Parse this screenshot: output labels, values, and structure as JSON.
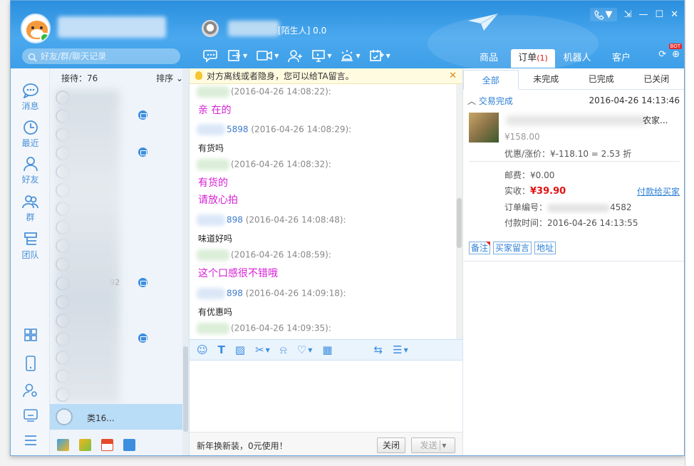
{
  "search": {
    "placeholder": "好友/群/聊天记录"
  },
  "contact": {
    "status": "[陌生人] 0.0"
  },
  "toolbar": {
    "icons": [
      "chat-transfer-icon",
      "share-screen-icon",
      "video-call-icon",
      "add-friend-icon",
      "remote-assist-icon",
      "alarm-icon",
      "calendar-task-icon"
    ]
  },
  "right_tabs": [
    {
      "label": "商品",
      "count": ""
    },
    {
      "label": "订单",
      "count": "(1)"
    },
    {
      "label": "机器人",
      "count": ""
    },
    {
      "label": "客户",
      "count": ""
    }
  ],
  "bot_badge": "BOT",
  "nav": [
    {
      "label": "消息",
      "icon": "message-icon"
    },
    {
      "label": "最近",
      "icon": "clock-icon"
    },
    {
      "label": "好友",
      "icon": "person-icon"
    },
    {
      "label": "群",
      "icon": "group-icon"
    },
    {
      "label": "团队",
      "icon": "team-icon"
    }
  ],
  "contact_list": {
    "reception_label": "接待：76",
    "sort_label": "排序",
    "selected_name": "类16...",
    "fragments": [
      "92"
    ]
  },
  "chat": {
    "notice": "对方离线或者隐身，您可以给TA留言。",
    "messages": [
      {
        "role": "seller",
        "name_frag": "",
        "time": "(2016-04-26 14:08:22):",
        "lines": [
          "亲 在的"
        ]
      },
      {
        "role": "customer",
        "name_frag": "5898",
        "time": "(2016-04-26 14:08:29):",
        "lines": [
          "有货吗"
        ]
      },
      {
        "role": "seller",
        "name_frag": "",
        "time": "(2016-04-26 14:08:32):",
        "lines": [
          "有货的",
          "请放心拍"
        ]
      },
      {
        "role": "customer",
        "name_frag": "898",
        "time": "(2016-04-26 14:08:48):",
        "lines": [
          "味道好吗"
        ]
      },
      {
        "role": "seller",
        "name_frag": "",
        "time": "(2016-04-26 14:08:59):",
        "lines": [
          "这个口感很不错哦"
        ]
      },
      {
        "role": "customer",
        "name_frag": "898",
        "time": "(2016-04-26 14:09:18):",
        "lines": [
          "有优惠吗"
        ]
      },
      {
        "role": "seller",
        "name_frag": "",
        "time": "(2016-04-26 14:09:35):",
        "lines": []
      }
    ],
    "promo": "新年换新装，0元使用！",
    "close_label": "关闭",
    "send_label": "发送"
  },
  "orders": {
    "tabs": [
      "全部",
      "未完成",
      "已完成",
      "已关闭"
    ],
    "status": "交易完成",
    "date": "2016-04-26 14:13:46",
    "title_frag": "农家...",
    "price": "¥158.00",
    "discount": "优惠/涨价：¥-118.10 = 2.53 折",
    "shipping": "邮费：¥0.00",
    "paid_label": "实收：",
    "paid_value": "¥39.90",
    "pay_link": "付款给买家",
    "order_no_label": "订单编号：",
    "order_no_frag": "4582",
    "pay_time": "付款时间：2016-04-26 14:13:55",
    "tags": [
      "备注",
      "买家留言",
      "地址"
    ]
  },
  "colors": {
    "header": "#3d9fe8",
    "accent": "#2d7fd6",
    "seller_text": "#d61fd6",
    "price_red": "#e01313"
  }
}
